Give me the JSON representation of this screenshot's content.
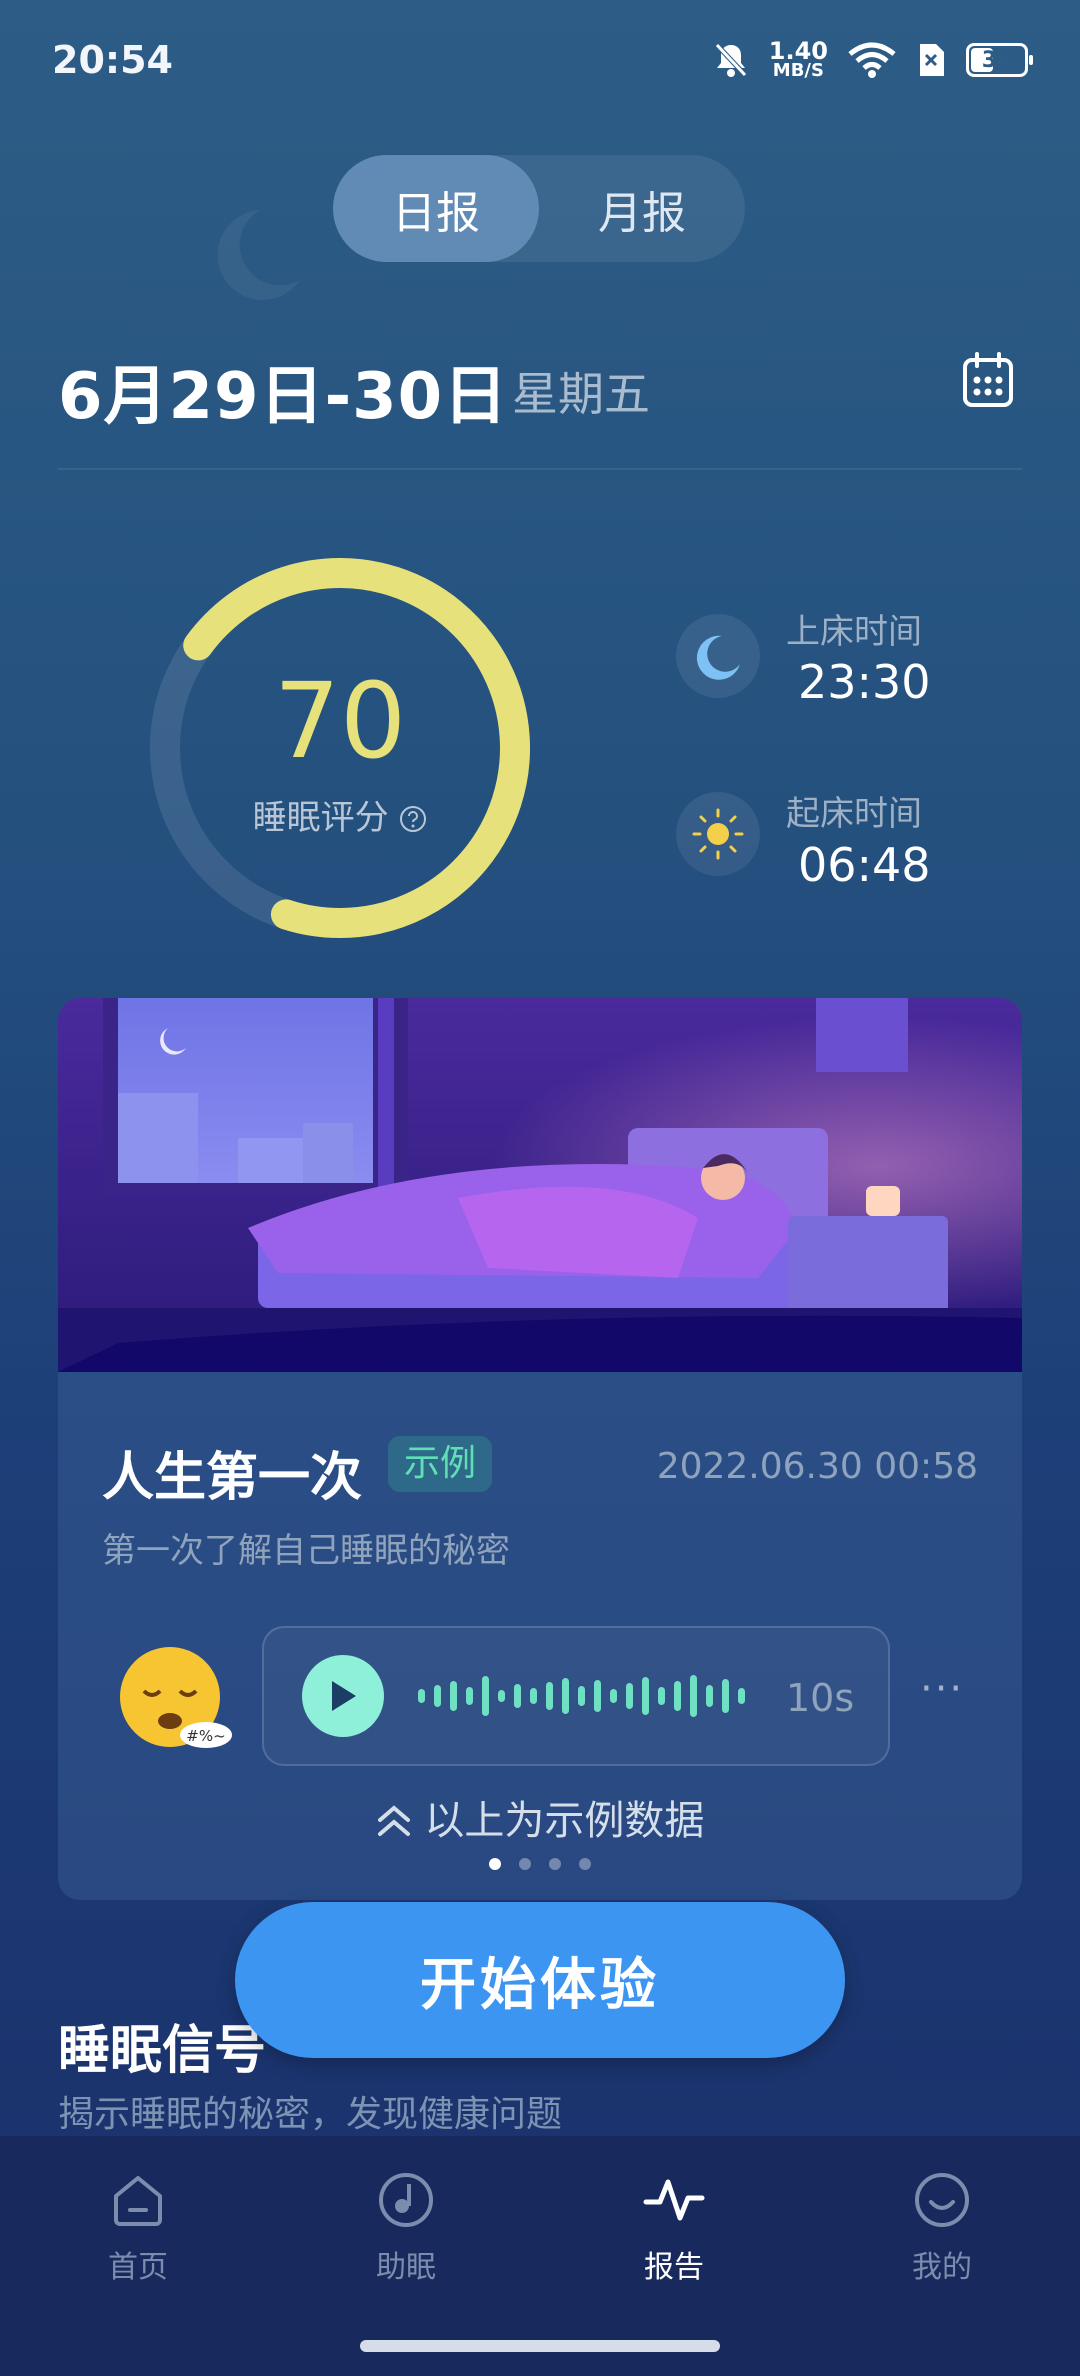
{
  "status_bar": {
    "time": "20:54",
    "speed_value": "1.40",
    "speed_unit": "MB/S",
    "battery": "34"
  },
  "tabs": [
    {
      "label": "日报",
      "active": true
    },
    {
      "label": "月报",
      "active": false
    }
  ],
  "header": {
    "date": "6月29日-30日",
    "weekday": "星期五"
  },
  "score": {
    "value": "70",
    "label": "睡眠评分",
    "fraction": 0.7,
    "ring_color": "#e6e17a"
  },
  "bedtime": {
    "label": "上床时间",
    "value": "23:30"
  },
  "waketime": {
    "label": "起床时间",
    "value": "06:48"
  },
  "card": {
    "title": "人生第一次",
    "badge": "示例",
    "datetime": "2022.06.30 00:58",
    "subtitle": "第一次了解自己睡眠的秘密",
    "emoji_text": "#%~",
    "audio_duration": "10s",
    "more": "···",
    "sample_note": "以上为示例数据",
    "page_count": 4,
    "page_index": 0
  },
  "cta": {
    "label": "开始体验"
  },
  "section": {
    "title": "睡眠信号",
    "subtitle": "揭示睡眠的秘密，发现健康问题"
  },
  "nav": [
    {
      "label": "首页",
      "icon": "home-icon"
    },
    {
      "label": "助眠",
      "icon": "sleep-aid-icon"
    },
    {
      "label": "报告",
      "icon": "report-icon",
      "active": true
    },
    {
      "label": "我的",
      "icon": "profile-icon"
    }
  ]
}
